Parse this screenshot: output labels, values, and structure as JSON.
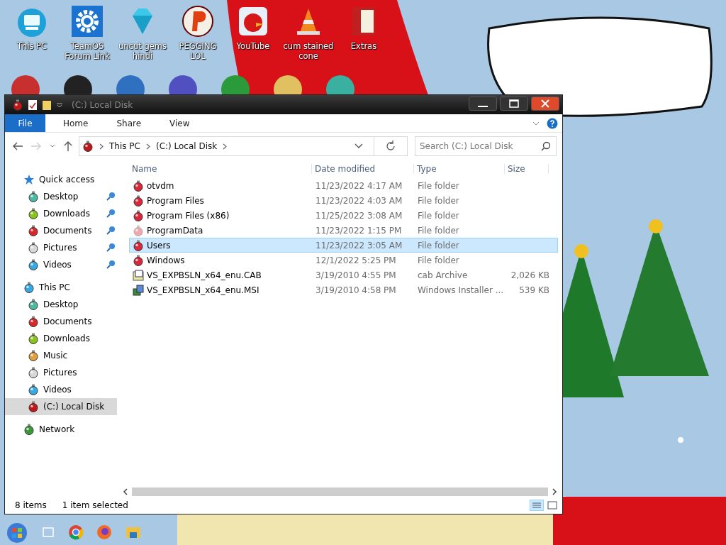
{
  "desktop_icons": [
    {
      "label": "This PC",
      "kind": "pc"
    },
    {
      "label": "TeamOS Forum Link",
      "kind": "gear"
    },
    {
      "label": "uncut gems hindi",
      "kind": "gem"
    },
    {
      "label": "PEGGING LOL",
      "kind": "letter"
    },
    {
      "label": "YouTube",
      "kind": "bird"
    },
    {
      "label": "cum stained cone",
      "kind": "cone"
    },
    {
      "label": "Extras",
      "kind": "folder"
    }
  ],
  "window": {
    "title": "(C:) Local Disk",
    "ribbon_tabs": [
      {
        "label": "File",
        "kind": "file"
      },
      {
        "label": "Home",
        "kind": "plain"
      },
      {
        "label": "Share",
        "kind": "plain"
      },
      {
        "label": "View",
        "kind": "plain"
      }
    ],
    "address": [
      "This PC",
      "(C:) Local Disk"
    ],
    "search": {
      "placeholder": "Search (C:) Local Disk"
    },
    "sidebar": [
      {
        "label": "Quick access",
        "kind": "star",
        "selected": false,
        "children": [
          {
            "label": "Desktop",
            "color": "#4fb8a0",
            "pinned": true,
            "selected": false
          },
          {
            "label": "Downloads",
            "color": "#8cc21e",
            "pinned": true,
            "selected": false
          },
          {
            "label": "Documents",
            "color": "#d8282c",
            "pinned": true,
            "selected": false
          },
          {
            "label": "Pictures",
            "color": "#d8d8d8",
            "pinned": true,
            "selected": false
          },
          {
            "label": "Videos",
            "color": "#3aa8e0",
            "pinned": true,
            "selected": false
          }
        ]
      },
      {
        "label": "This PC",
        "kind": "pc",
        "selected": false,
        "children": [
          {
            "label": "Desktop",
            "color": "#4fb8a0",
            "pinned": false,
            "selected": false
          },
          {
            "label": "Documents",
            "color": "#d8282c",
            "pinned": false,
            "selected": false
          },
          {
            "label": "Downloads",
            "color": "#8cc21e",
            "pinned": false,
            "selected": false
          },
          {
            "label": "Music",
            "color": "#e0a040",
            "pinned": false,
            "selected": false
          },
          {
            "label": "Pictures",
            "color": "#d8d8d8",
            "pinned": false,
            "selected": false
          },
          {
            "label": "Videos",
            "color": "#3aa8e0",
            "pinned": false,
            "selected": false
          },
          {
            "label": "(C:) Local Disk",
            "color": "#c01818",
            "pinned": false,
            "selected": true
          }
        ]
      },
      {
        "label": "Network",
        "kind": "network",
        "selected": false
      }
    ],
    "columns": [
      "Name",
      "Date modified",
      "Type",
      "Size"
    ],
    "rows": [
      {
        "name": "otvdm",
        "date": "11/23/2022 4:17 AM",
        "type": "File folder",
        "kind": "folder",
        "dimmed": false,
        "selected": false
      },
      {
        "name": "Program Files",
        "date": "11/23/2022 4:03 AM",
        "type": "File folder",
        "kind": "folder",
        "dimmed": false,
        "selected": false
      },
      {
        "name": "Program Files (x86)",
        "date": "11/25/2022 3:08 AM",
        "type": "File folder",
        "kind": "folder",
        "dimmed": false,
        "selected": false
      },
      {
        "name": "ProgramData",
        "date": "11/23/2022 1:15 PM",
        "type": "File folder",
        "kind": "folder",
        "dimmed": true,
        "selected": false
      },
      {
        "name": "Users",
        "date": "11/23/2022 3:05 AM",
        "type": "File folder",
        "kind": "folder",
        "dimmed": false,
        "selected": true
      },
      {
        "name": "Windows",
        "date": "12/1/2022 5:25 PM",
        "type": "File folder",
        "kind": "folder",
        "dimmed": false,
        "selected": false
      },
      {
        "name": "VS_EXPBSLN_x64_enu.CAB",
        "date": "3/19/2010 4:55 PM",
        "type": "cab Archive",
        "size": "2,026 KB",
        "kind": "cab",
        "dimmed": false,
        "selected": false
      },
      {
        "name": "VS_EXPBSLN_x64_enu.MSI",
        "date": "3/19/2010 4:58 PM",
        "type": "Windows Installer ...",
        "size": "539 KB",
        "kind": "msi",
        "dimmed": false,
        "selected": false
      }
    ],
    "status": {
      "count": "8 items",
      "selection": "1 item selected"
    }
  }
}
